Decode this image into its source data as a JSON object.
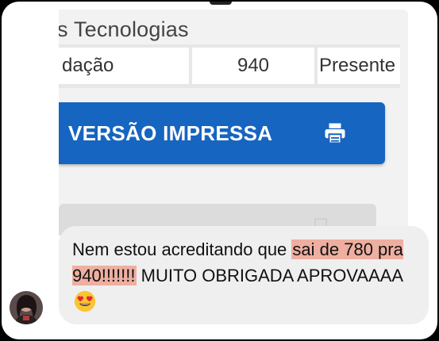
{
  "shared_screenshot": {
    "section_title": "s Tecnologias",
    "grade_row": {
      "subject": "dação",
      "score": "940",
      "status": "Presente"
    },
    "print_button_label": "VERSÃO IMPRESSA",
    "print_icon": "printer-icon"
  },
  "message": {
    "text_before": "Nem estou acreditando que ",
    "highlight": "sai de 780 pra 940!!!!!!!",
    "text_after": " MUITO OBRIGADA APROVAAAA",
    "emoji": "heart-eyes-emoji",
    "highlight_color": "#eeafa0",
    "bubble_color": "#efefef"
  },
  "sender": {
    "avatar": "avatar"
  },
  "colors": {
    "button_blue": "#1665c0",
    "frame": "#000000"
  }
}
